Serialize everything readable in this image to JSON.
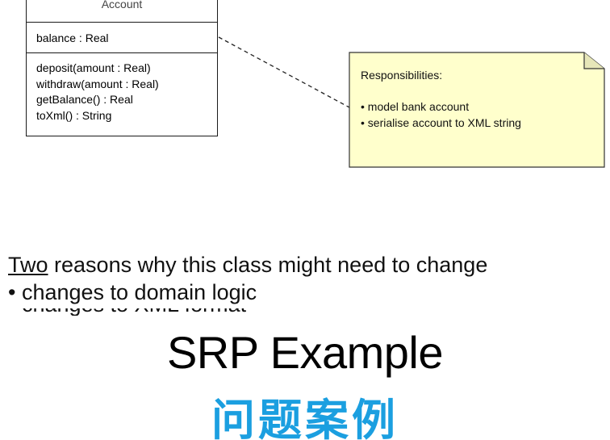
{
  "class_box": {
    "name": "Account",
    "attributes": [
      "balance : Real"
    ],
    "operations": [
      "deposit(amount : Real)",
      "withdraw(amount : Real)",
      "getBalance() : Real",
      "toXml() : String"
    ]
  },
  "note": {
    "title": "Responsibilities:",
    "items": [
      "• model bank account",
      "• serialise account to XML string"
    ],
    "fill_color": "#ffffcc",
    "border_color": "#333333"
  },
  "reasons": {
    "underlined_word": "Two",
    "heading_rest": " reasons why this class might need to change",
    "items": [
      "• changes to domain logic"
    ],
    "clipped_item": "• changes to XML format"
  },
  "title": "SRP Example",
  "subtitle": "问题案例",
  "colors": {
    "subtitle": "#1b9fe0",
    "text": "#000000"
  }
}
